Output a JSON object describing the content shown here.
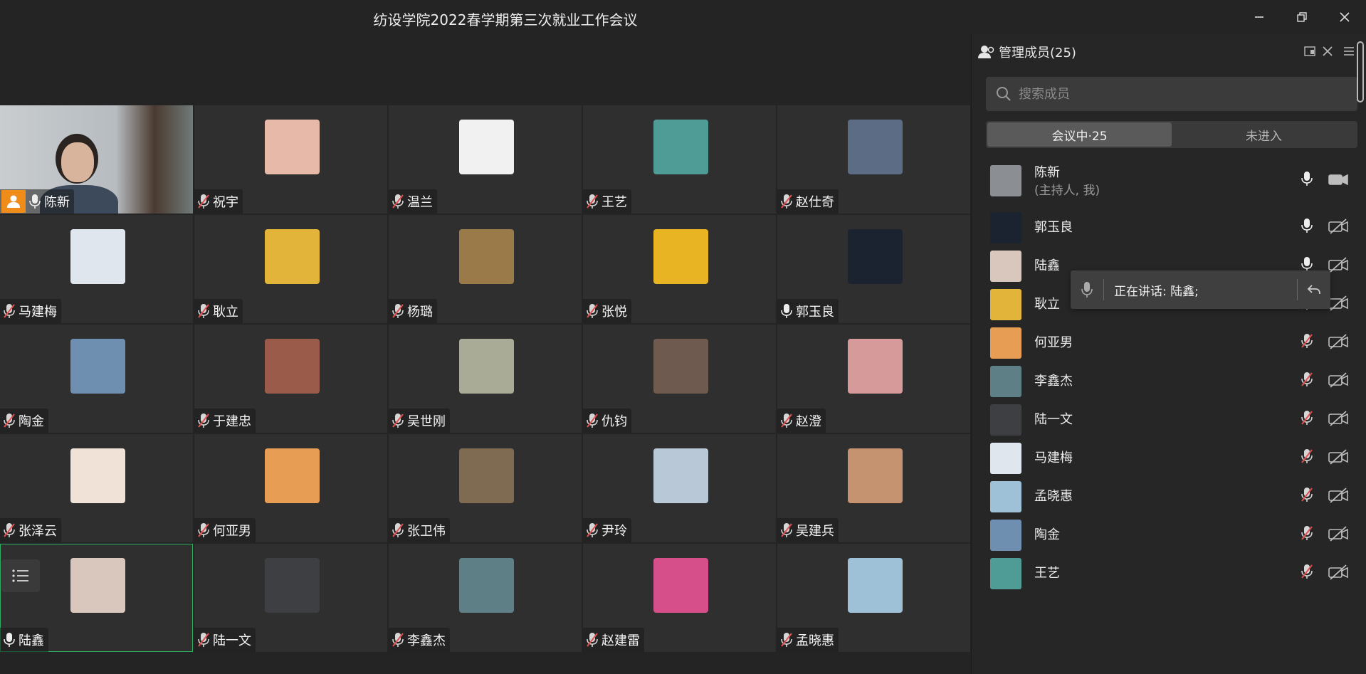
{
  "window": {
    "title": "纺设学院2022春学期第三次就业工作会议"
  },
  "colors": {
    "host_badge": "#f08c1a",
    "active_border": "#2fae5e",
    "muted_mic": "#cfcfcf"
  },
  "tiles": [
    {
      "name": "陈新",
      "mic": "on",
      "host": true,
      "video": true,
      "avatar_bg": "#9aa4ad"
    },
    {
      "name": "祝宇",
      "mic": "muted",
      "avatar_bg": "#e7b9a8"
    },
    {
      "name": "温兰",
      "mic": "muted",
      "avatar_bg": "#f1f1f1"
    },
    {
      "name": "王艺",
      "mic": "muted",
      "avatar_bg": "#4f9c96"
    },
    {
      "name": "赵仕奇",
      "mic": "muted",
      "avatar_bg": "#5b6c84"
    },
    {
      "name": "马建梅",
      "mic": "muted",
      "avatar_bg": "#dfe6ee"
    },
    {
      "name": "耿立",
      "mic": "muted",
      "avatar_bg": "#e3b43a"
    },
    {
      "name": "杨璐",
      "mic": "muted",
      "avatar_bg": "#9b7a4a"
    },
    {
      "name": "张悦",
      "mic": "muted",
      "avatar_bg": "#e8b424"
    },
    {
      "name": "郭玉良",
      "mic": "on",
      "avatar_bg": "#1b2330"
    },
    {
      "name": "陶金",
      "mic": "muted",
      "avatar_bg": "#6e8fb0"
    },
    {
      "name": "于建忠",
      "mic": "muted",
      "avatar_bg": "#9a5b4b"
    },
    {
      "name": "吴世刚",
      "mic": "muted",
      "avatar_bg": "#a9ab97"
    },
    {
      "name": "仇钧",
      "mic": "muted",
      "avatar_bg": "#6e5a4e"
    },
    {
      "name": "赵澄",
      "mic": "muted",
      "avatar_bg": "#d79a9a"
    },
    {
      "name": "张泽云",
      "mic": "muted",
      "avatar_bg": "#f0e2d6"
    },
    {
      "name": "何亚男",
      "mic": "muted",
      "avatar_bg": "#e79d54"
    },
    {
      "name": "张卫伟",
      "mic": "muted",
      "avatar_bg": "#7f6a52"
    },
    {
      "name": "尹玲",
      "mic": "muted",
      "avatar_bg": "#b9c8d6"
    },
    {
      "name": "吴建兵",
      "mic": "muted",
      "avatar_bg": "#c59370"
    },
    {
      "name": "陆鑫",
      "mic": "on",
      "active": true,
      "avatar_bg": "#d9c6bd"
    },
    {
      "name": "陆一文",
      "mic": "muted",
      "avatar_bg": "#3d3f42"
    },
    {
      "name": "李鑫杰",
      "mic": "muted",
      "avatar_bg": "#5f7f86"
    },
    {
      "name": "赵建雷",
      "mic": "muted",
      "avatar_bg": "#d64e8a"
    },
    {
      "name": "孟晓惠",
      "mic": "muted",
      "avatar_bg": "#9ec1d8"
    }
  ],
  "panel": {
    "title": "管理成员(25)",
    "search_placeholder": "搜索成员",
    "tab_in_meeting": "会议中·25",
    "tab_not_joined": "未进入",
    "members": [
      {
        "name": "陈新",
        "sub": "(主持人, 我)",
        "mic": "on",
        "cam": "on",
        "avatar_bg": "#8b8f94"
      },
      {
        "name": "郭玉良",
        "mic": "on",
        "cam": "off",
        "avatar_bg": "#1b2330"
      },
      {
        "name": "陆鑫",
        "mic": "on",
        "cam": "off",
        "avatar_bg": "#d9c6bd"
      },
      {
        "name": "耿立",
        "mic": "muted",
        "cam": "off",
        "avatar_bg": "#e3b43a"
      },
      {
        "name": "何亚男",
        "mic": "muted",
        "cam": "off",
        "avatar_bg": "#e79d54"
      },
      {
        "name": "李鑫杰",
        "mic": "muted",
        "cam": "off",
        "avatar_bg": "#5f7f86"
      },
      {
        "name": "陆一文",
        "mic": "muted",
        "cam": "off",
        "avatar_bg": "#3d3f42"
      },
      {
        "name": "马建梅",
        "mic": "muted",
        "cam": "off",
        "avatar_bg": "#dfe6ee"
      },
      {
        "name": "孟晓惠",
        "mic": "muted",
        "cam": "off",
        "avatar_bg": "#9ec1d8"
      },
      {
        "name": "陶金",
        "mic": "muted",
        "cam": "off",
        "avatar_bg": "#6e8fb0"
      },
      {
        "name": "王艺",
        "mic": "muted",
        "cam": "off",
        "avatar_bg": "#4f9c96"
      }
    ]
  },
  "speaking_toast": {
    "text": "正在讲话: 陆鑫;"
  }
}
